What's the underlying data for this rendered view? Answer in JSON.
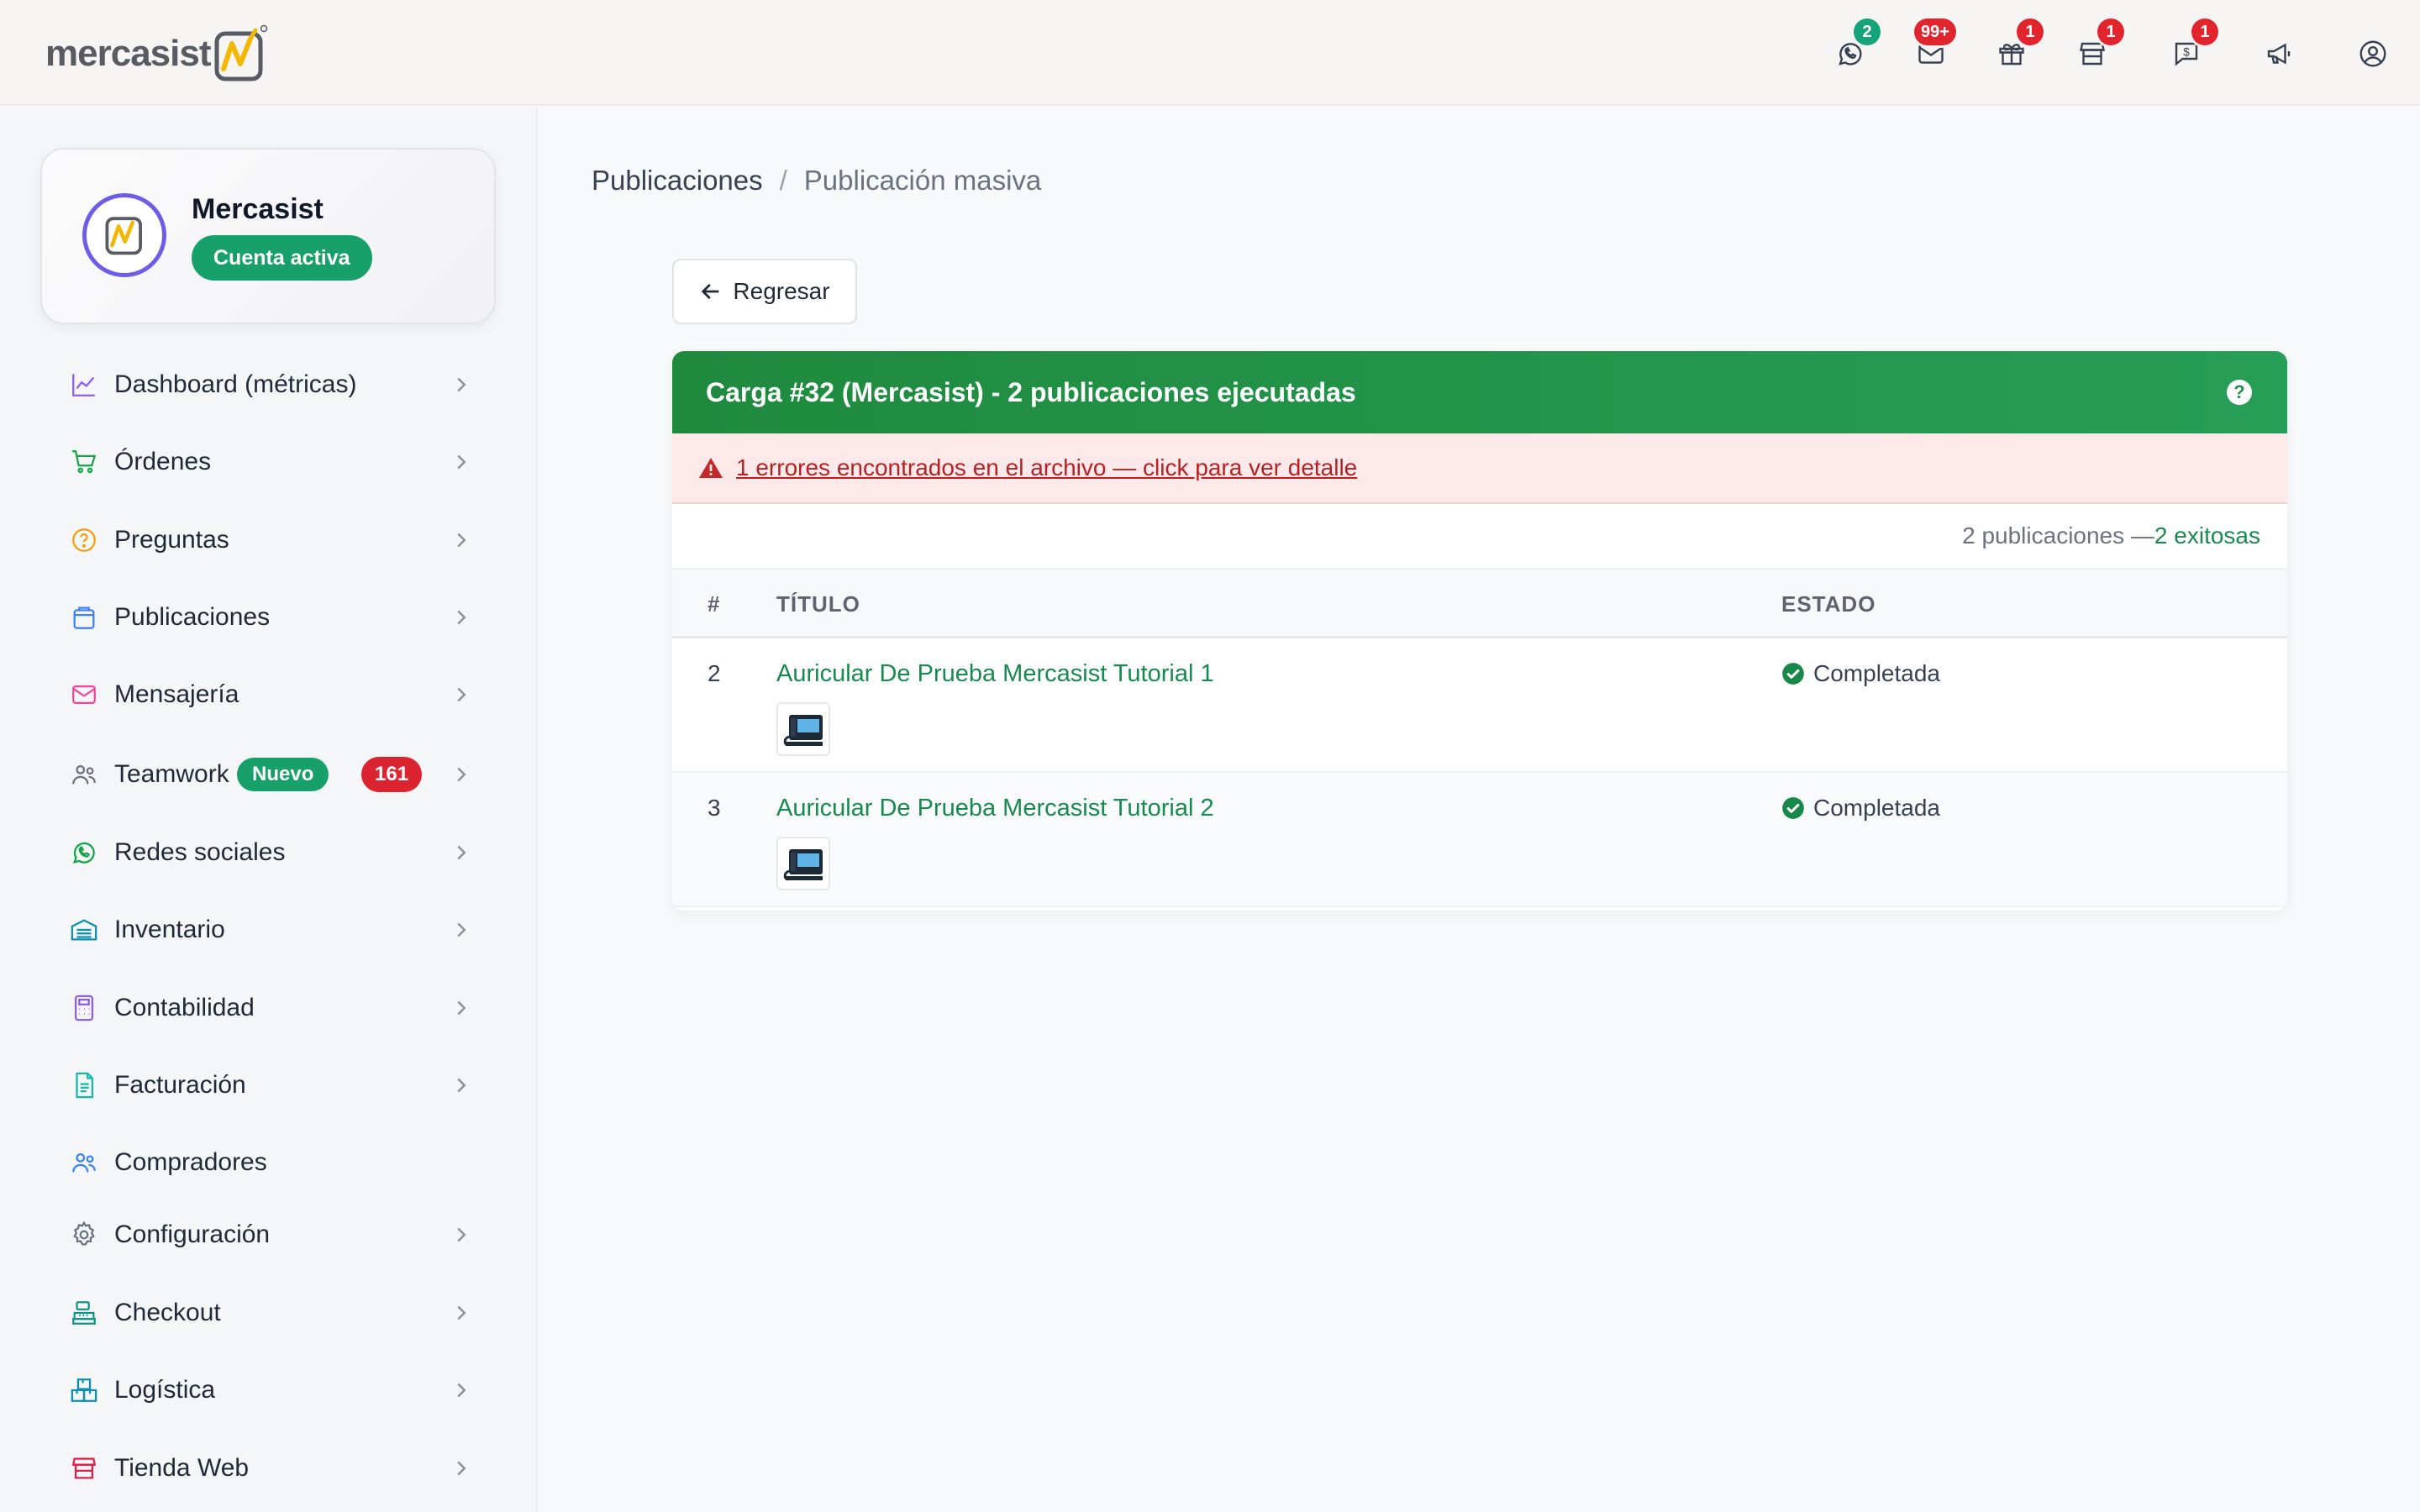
{
  "brand": {
    "logo_text": "mercasist"
  },
  "topbar": {
    "icons": [
      {
        "name": "whatsapp-icon",
        "badge": "2",
        "badge_color": "#16a37a"
      },
      {
        "name": "mail-icon",
        "badge": "99+",
        "badge_color": "#e0252e"
      },
      {
        "name": "box-icon",
        "badge": "1",
        "badge_color": "#e0252e"
      },
      {
        "name": "store-icon",
        "badge": "1",
        "badge_color": "#e0252e"
      },
      {
        "name": "dollar-message-icon",
        "badge": "1",
        "badge_color": "#e0252e"
      },
      {
        "name": "megaphone-icon",
        "badge": ""
      },
      {
        "name": "user-circle-icon",
        "badge": ""
      }
    ]
  },
  "account": {
    "name": "Mercasist",
    "status": "Cuenta activa"
  },
  "sidebar": {
    "items": [
      {
        "label": "Dashboard (métricas)",
        "icon": "chart-line-icon",
        "has_chevron": true
      },
      {
        "label": "Órdenes",
        "icon": "cart-icon",
        "has_chevron": true
      },
      {
        "label": "Preguntas",
        "icon": "question-circle-icon",
        "has_chevron": true
      },
      {
        "label": "Publicaciones",
        "icon": "bag-icon",
        "has_chevron": true
      },
      {
        "label": "Mensajería",
        "icon": "mail-icon",
        "has_chevron": true
      },
      {
        "label": "Teamwork",
        "icon": "team-icon",
        "has_chevron": true,
        "pill_new": "Nuevo",
        "pill_count": "161"
      },
      {
        "label": "Redes sociales",
        "icon": "whatsapp-icon",
        "has_chevron": true
      },
      {
        "label": "Inventario",
        "icon": "warehouse-icon",
        "has_chevron": true
      },
      {
        "label": "Contabilidad",
        "icon": "calculator-icon",
        "has_chevron": true
      },
      {
        "label": "Facturación",
        "icon": "invoice-icon",
        "has_chevron": true
      },
      {
        "label": "Compradores",
        "icon": "buyers-icon",
        "has_chevron": false
      },
      {
        "label": "Configuración",
        "icon": "gear-icon",
        "has_chevron": true
      },
      {
        "label": "Checkout",
        "icon": "register-icon",
        "has_chevron": true
      },
      {
        "label": "Logística",
        "icon": "boxes-icon",
        "has_chevron": true
      },
      {
        "label": "Tienda Web",
        "icon": "webstore-icon",
        "has_chevron": true
      }
    ]
  },
  "breadcrumb": {
    "parent": "Publicaciones",
    "separator": "/",
    "current": "Publicación masiva"
  },
  "back_button": {
    "label": "Regresar"
  },
  "card": {
    "title": "Carga #32 (Mercasist) - 2 publicaciones ejecutadas",
    "help": "?",
    "error_text": "1 errores encontrados en el archivo — click para ver detalle",
    "summary_prefix": "2 publicaciones —",
    "summary_success": "2 exitosas",
    "columns": {
      "num": "#",
      "title": "TÍTULO",
      "status": "ESTADO"
    },
    "rows": [
      {
        "num": "2",
        "title": "Auricular De Prueba Mercasist Tutorial 1",
        "status": "Completada"
      },
      {
        "num": "3",
        "title": "Auricular De Prueba Mercasist Tutorial 2",
        "status": "Completada"
      }
    ]
  },
  "colors": {
    "accent_green": "#18a06b",
    "header_green": "#249a51",
    "error_red": "#b42324",
    "badge_red": "#e0252e",
    "avatar_ring": "#6d5de6"
  }
}
